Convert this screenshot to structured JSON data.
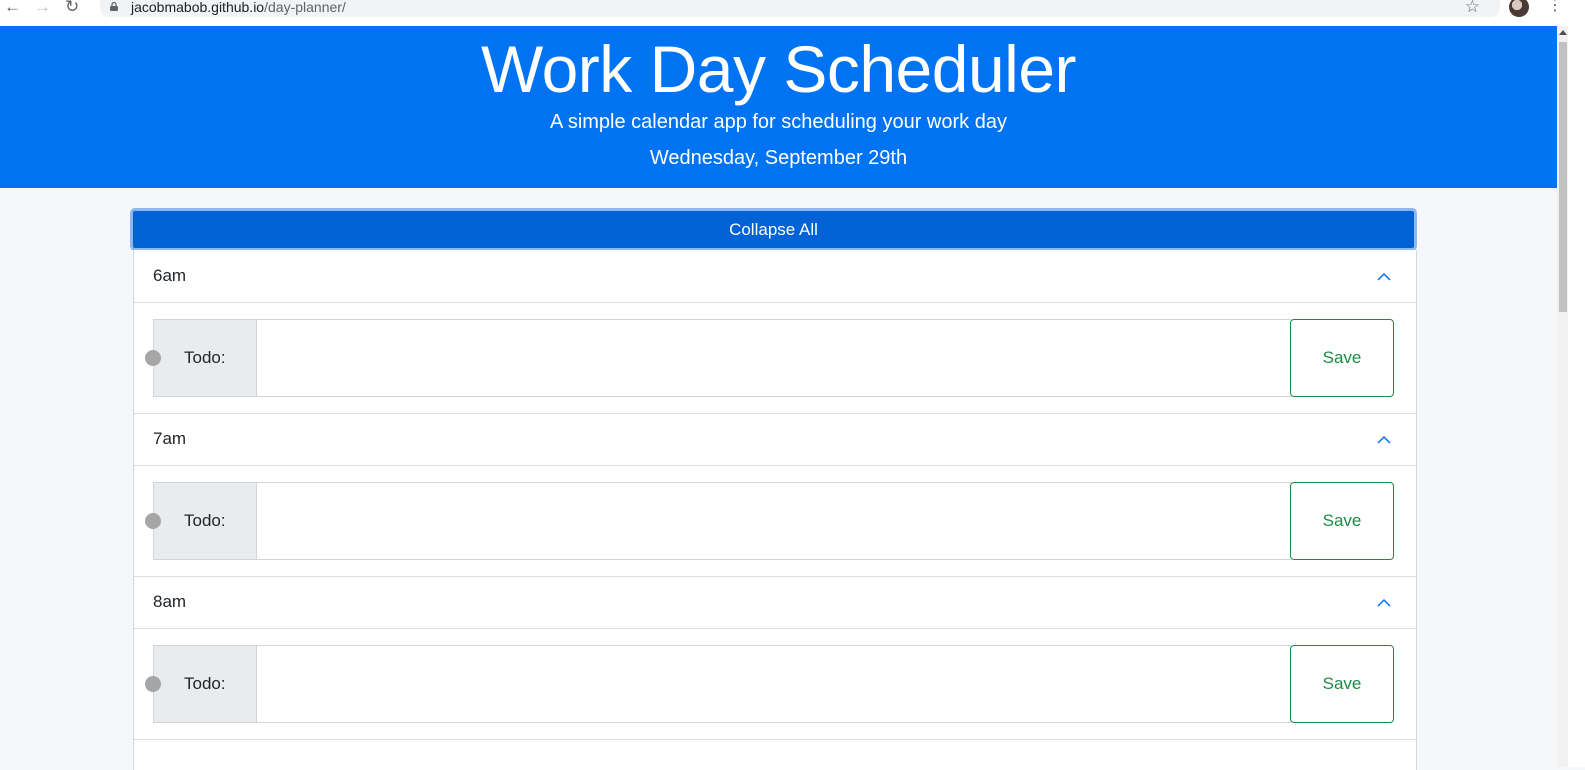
{
  "browser": {
    "url_host": "jacobmabob.github.io",
    "url_path": "/day-planner/"
  },
  "header": {
    "title": "Work Day Scheduler",
    "lead": "A simple calendar app for scheduling your work day",
    "date": "Wednesday, September 29th"
  },
  "collapse_all_label": "Collapse All",
  "hours": [
    {
      "label": "6am",
      "todo_label": "Todo:",
      "todo_value": "",
      "save_label": "Save",
      "status": "past"
    },
    {
      "label": "7am",
      "todo_label": "Todo:",
      "todo_value": "",
      "save_label": "Save",
      "status": "past"
    },
    {
      "label": "8am",
      "todo_label": "Todo:",
      "todo_value": "",
      "save_label": "Save",
      "status": "past"
    }
  ],
  "colors": {
    "header_bg": "#0073f2",
    "collapse_bg": "#0062d5",
    "save_color": "#1e8b45",
    "status_dot": "#a6a6a6",
    "chevron": "#0073f2"
  }
}
